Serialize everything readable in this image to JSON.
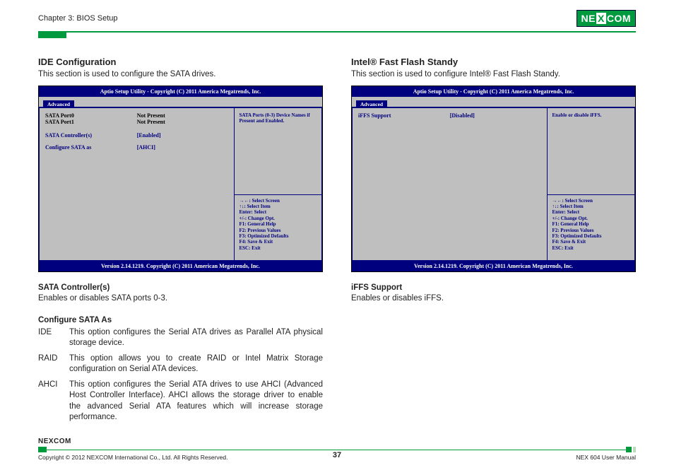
{
  "header": {
    "chapter": "Chapter 3: BIOS Setup",
    "logo_text_left": "NE",
    "logo_text_x": "X",
    "logo_text_right": "COM"
  },
  "left": {
    "title": "IDE Configuration",
    "desc": "This section is used to configure the SATA drives.",
    "bios": {
      "title": "Aptio Setup Utility - Copyright (C) 2011 America Megatrends, Inc.",
      "tab": "Advanced",
      "rows": [
        {
          "label": "SATA Port0",
          "val": "Not Present",
          "cls": "black"
        },
        {
          "label": "SATA Port1",
          "val": "Not Present",
          "cls": "black"
        }
      ],
      "rows2": [
        {
          "label": "SATA Controller(s)",
          "val": "[Enabled]",
          "cls": "blue"
        },
        {
          "label": "Configure SATA as",
          "val": "[AHCI]",
          "cls": "blue"
        }
      ],
      "help_top": "SATA Ports (0-3) Device Names if Present and Enabled.",
      "help_bot": [
        "→←: Select Screen",
        "↑↓: Select Item",
        "Enter: Select",
        "+/-: Change Opt.",
        "F1: General Help",
        "F2: Previous Values",
        "F3: Optimized Defaults",
        "F4: Save & Exit",
        "ESC: Exit"
      ],
      "footer": "Version 2.14.1219. Copyright (C) 2011 American Megatrends, Inc."
    },
    "sub1_title": "SATA Controller(s)",
    "sub1_desc": "Enables or disables SATA ports 0-3.",
    "sub2_title": "Configure SATA As",
    "opts": [
      {
        "k": "IDE",
        "v": "This option configures the Serial ATA drives as Parallel ATA physical storage device."
      },
      {
        "k": "RAID",
        "v": "This option allows you to create RAID or Intel Matrix Storage configuration on Serial ATA devices."
      },
      {
        "k": "AHCI",
        "v": "This option configures the Serial ATA drives to use AHCI (Advanced Host Controller Interface). AHCI allows the storage driver to enable the advanced Serial ATA features which will increase storage performance."
      }
    ]
  },
  "right": {
    "title": "Intel® Fast Flash Standy",
    "desc": "This section is used to configure Intel® Fast Flash Standy.",
    "bios": {
      "title": "Aptio Setup Utility - Copyright (C) 2011 America Megatrends, Inc.",
      "tab": "Advanced",
      "rows": [
        {
          "label": "iFFS Support",
          "val": "[Disabled]",
          "cls": "blue"
        }
      ],
      "help_top": "Enable or disable iFFS.",
      "help_bot": [
        "→←: Select Screen",
        "↑↓: Select Item",
        "Enter: Select",
        "+/-: Change Opt.",
        "F1: General Help",
        "F2: Previous Values",
        "F3: Optimized Defaults",
        "F4: Save & Exit",
        "ESC: Exit"
      ],
      "footer": "Version 2.14.1219. Copyright (C) 2011 American Megatrends, Inc."
    },
    "sub1_title": "iFFS Support",
    "sub1_desc": "Enables or disables iFFS."
  },
  "footer": {
    "logo": "NEXCOM",
    "copyright": "Copyright © 2012 NEXCOM International Co., Ltd. All Rights Reserved.",
    "page": "37",
    "manual": "NEX 604 User Manual"
  }
}
